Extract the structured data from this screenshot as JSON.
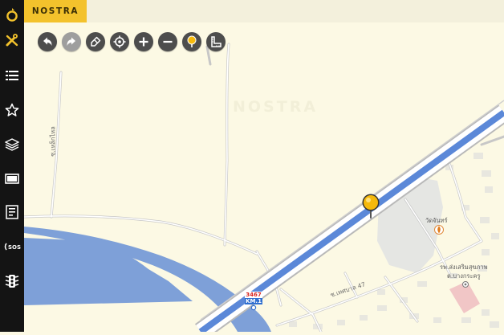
{
  "app": {
    "logo_text": "NOSTRA"
  },
  "sidebar": {
    "items": [
      {
        "name": "tools",
        "icon": "tools-icon"
      },
      {
        "name": "list",
        "icon": "list-icon"
      },
      {
        "name": "favorites",
        "icon": "star-icon"
      },
      {
        "name": "layers",
        "icon": "layers-icon"
      },
      {
        "name": "screen",
        "icon": "monitor-icon"
      },
      {
        "name": "report",
        "icon": "report-icon"
      },
      {
        "name": "sos",
        "icon": "sos-icon"
      },
      {
        "name": "traffic",
        "icon": "traffic-light-icon"
      }
    ]
  },
  "toolbar": {
    "buttons": [
      {
        "name": "undo",
        "icon": "undo-icon",
        "enabled": true
      },
      {
        "name": "redo",
        "icon": "redo-icon",
        "enabled": false
      },
      {
        "name": "clear",
        "icon": "eraser-icon",
        "enabled": true
      },
      {
        "name": "locate",
        "icon": "crosshair-icon",
        "enabled": true
      },
      {
        "name": "zoom-in",
        "icon": "plus-icon",
        "enabled": true
      },
      {
        "name": "zoom-out",
        "icon": "minus-icon",
        "enabled": true
      },
      {
        "name": "pin",
        "icon": "pin-icon",
        "enabled": true
      },
      {
        "name": "measure",
        "icon": "ruler-icon",
        "enabled": true
      }
    ]
  },
  "map": {
    "watermark": "NOSTRA",
    "labels": {
      "road_left": "ซ.เหล็กไหล",
      "road_bottom": "ซ.เทศบาล 47",
      "temple": "วัดจันทร์",
      "hospital_line1": "รพ.ส่งเสริมสุขภาพ",
      "hospital_line2": "ต.บางกระครู"
    },
    "km_marker": {
      "number": "3467",
      "km": "KM.1"
    },
    "colors": {
      "land": "#fcf9e4",
      "water": "#7ea0d8",
      "highway": "#5b88d8",
      "area": "#e5e6e3",
      "pin": "#f5b90c",
      "accent": "#f3c22c"
    }
  }
}
